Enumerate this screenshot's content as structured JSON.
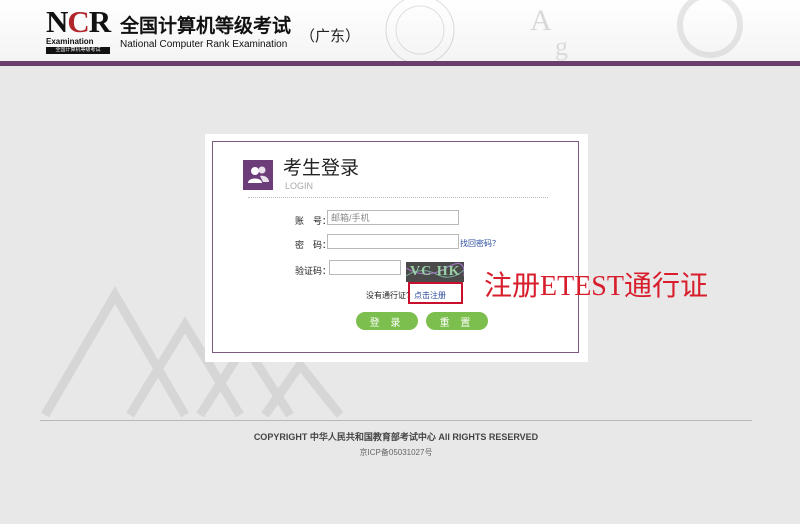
{
  "header": {
    "logo_text": "NCR",
    "logo_exam": "Examination",
    "logo_sub": "全国计算机等级考试",
    "title_cn": "全国计算机等级考试",
    "title_en": "National Computer Rank Examination",
    "region": "（广东）"
  },
  "login": {
    "title": "考生登录",
    "subtitle": "LOGIN",
    "account_label": "账　号：",
    "account_placeholder": "邮箱/手机",
    "password_label": "密　码：",
    "forgot_password": "找回密码？",
    "captcha_label": "验证码：",
    "captcha_text": "VC HK",
    "no_pass_text": "没有通行证?",
    "register_link": "点击注册",
    "login_button": "登 录",
    "reset_button": "重 置"
  },
  "annotation": "注册ETEST通行证",
  "footer": {
    "copyright": "COPYRIGHT 中华人民共和国教育部考试中心 All RIGHTS RESERVED",
    "icp": "京ICP备05031027号"
  },
  "colors": {
    "accent_purple": "#6a3f6e",
    "button_green": "#7dbf4e",
    "annotation_red": "#d81e2c"
  }
}
